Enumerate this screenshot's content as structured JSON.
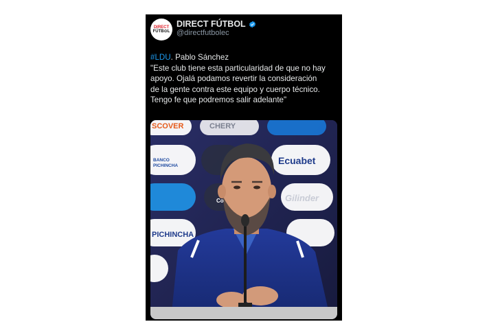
{
  "post": {
    "author_name": "DIRECT FÚTBOL",
    "author_handle": "@directfutbolec",
    "avatar_line1": "DIRECT",
    "avatar_line2": "FÚTB⊙L",
    "hashtag": "#LDU",
    "text_after_hashtag": ". Pablo Sánchez",
    "quote_line1": "\"Este club tiene esta particularidad de que no hay",
    "quote_line2": "apoyo. Ojalá podamos revertir la consideración",
    "quote_line3": "de la gente contra este equipo y cuerpo técnico.",
    "quote_line4": "Tengo fe que podremos salir adelante\""
  },
  "media": {
    "sponsors": [
      "SCOVER",
      "CHERY",
      "BANCO PICHINCHA",
      "Ecuabet",
      "Cobre",
      "Gilinder",
      "PICHINCHA"
    ]
  },
  "colors": {
    "accent": "#1d9bf0",
    "background": "#000000",
    "text": "#e7e9ea",
    "muted": "#8b98a5"
  }
}
